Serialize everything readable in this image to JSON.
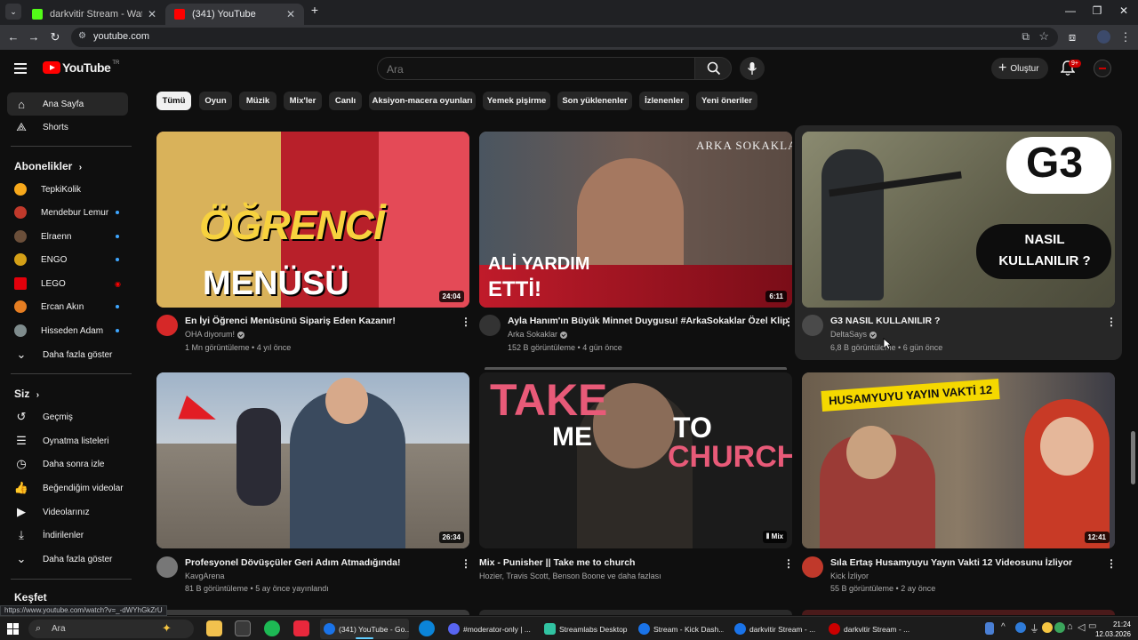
{
  "browser": {
    "tabs": [
      {
        "label": "darkvitir Stream - Watch Live on",
        "favicon_color": "#53fc18",
        "active": false
      },
      {
        "label": "(341) YouTube",
        "favicon_color": "#ff0000",
        "active": true
      }
    ],
    "new_tab": "+",
    "url": "youtube.com",
    "status_url": "https://www.youtube.com/watch?v=_-dWYhGkZrU"
  },
  "header": {
    "logo_text": "YouTube",
    "country_code": "TR",
    "search_placeholder": "Ara",
    "create_label": "Oluştur",
    "notification_count": "9+"
  },
  "sidebar": {
    "main": [
      {
        "label": "Ana Sayfa",
        "icon": "home-icon",
        "active": true
      },
      {
        "label": "Shorts",
        "icon": "shorts-icon",
        "active": false
      }
    ],
    "subscriptions_heading": "Abonelikler",
    "subscriptions": [
      {
        "label": "TepkiKolik",
        "color": "#f7a81b",
        "indicator": "none"
      },
      {
        "label": "Mendebur Lemur",
        "color": "#c0392b",
        "indicator": "dot"
      },
      {
        "label": "Elraenn",
        "color": "#6b4f3a",
        "indicator": "dot"
      },
      {
        "label": "ENGO",
        "color": "#d4a017",
        "indicator": "dot"
      },
      {
        "label": "LEGO",
        "color": "#e3000b",
        "indicator": "live"
      },
      {
        "label": "Ercan Akın",
        "color": "#e67e22",
        "indicator": "dot"
      },
      {
        "label": "Hisseden Adam",
        "color": "#7f8c8d",
        "indicator": "dot"
      }
    ],
    "show_more_subs": "Daha fazla göster",
    "you_heading": "Siz",
    "you_items": [
      {
        "label": "Geçmiş",
        "icon": "history-icon"
      },
      {
        "label": "Oynatma listeleri",
        "icon": "playlist-icon"
      },
      {
        "label": "Daha sonra izle",
        "icon": "watch-later-icon"
      },
      {
        "label": "Beğendiğim videolar",
        "icon": "like-icon"
      },
      {
        "label": "Videolarınız",
        "icon": "your-videos-icon"
      },
      {
        "label": "İndirilenler",
        "icon": "download-icon"
      }
    ],
    "show_more_you": "Daha fazla göster",
    "explore_heading": "Keşfet"
  },
  "chips": [
    "Tümü",
    "Oyun",
    "Müzik",
    "Mix'ler",
    "Canlı",
    "Aksiyon-macera oyunları",
    "Yemek pişirme",
    "Son yüklenenler",
    "İzlenenler",
    "Yeni öneriler"
  ],
  "videos": [
    {
      "title": "En İyi Öğrenci Menüsünü Sipariş Eden Kazanır!",
      "channel": "OHA diyorum!",
      "verified": true,
      "meta": "1 Mn görüntüleme • 4 yıl önce",
      "duration": "24:04",
      "thumb_text": "ÖĞRENCİ MENÜSÜ",
      "thumb_bg": "#b8202a",
      "avatar_color": "#d62828"
    },
    {
      "title": "Ayla Hanım'ın Büyük Minnet Duygusu! #ArkaSokaklar Özel Klip",
      "channel": "Arka Sokaklar",
      "verified": true,
      "meta": "152 B görüntüleme • 4 gün önce",
      "duration": "6:11",
      "thumb_text": "ALİ YARDIM ETTİ!",
      "thumb_corner": "ARKA SOKAKLAR",
      "thumb_bg": "#5a4a42",
      "avatar_color": "#333333"
    },
    {
      "title": "G3 NASIL KULLANILIR ?",
      "channel": "DeltaSays",
      "verified": true,
      "meta": "6,8 B görüntüleme • 6 gün önce",
      "duration": "",
      "thumb_text": "G3",
      "thumb_sub": "NASIL KULLANILIR ?",
      "thumb_bg": "#6b6a55",
      "avatar_color": "#4a4a4a"
    },
    {
      "title": "Profesyonel Dövüşçüler Geri Adım Atmadığında!",
      "channel": "KavgArena",
      "verified": false,
      "meta": "81 B görüntüleme • 5 ay önce yayınlandı",
      "duration": "26:34",
      "thumb_bg": "#7a8a9a",
      "avatar_color": "#777777"
    },
    {
      "title": "Mix - Punisher || Take me to church",
      "channel": "Hozier, Travis Scott, Benson Boone ve daha fazlası",
      "verified": false,
      "meta": "",
      "duration": "Mix",
      "thumb_text_a": "TAKE",
      "thumb_text_b": "ME",
      "thumb_text_c": "TO",
      "thumb_text_d": "CHURCH",
      "thumb_bg": "#1b1b1b",
      "avatar_color": ""
    },
    {
      "title": "Sıla Ertaş Husamyuyu Yayın Vakti 12 Videosunu İzliyor",
      "channel": "Kick İzliyor",
      "verified": false,
      "meta": "55 B görüntüleme • 2 ay önce",
      "duration": "12:41",
      "thumb_text": "HUSAMYUYU YAYIN VAKTİ 12",
      "thumb_bg": "#5d4e3f",
      "avatar_color": "#c0392b"
    }
  ],
  "taskbar": {
    "search_label": "Ara",
    "tasks": [
      {
        "label": "(341) YouTube - Go...",
        "color": "#ff0000",
        "active": true
      },
      {
        "label": "#moderator-only | ...",
        "color": "#5865f2",
        "active": false
      },
      {
        "label": "Streamlabs Desktop",
        "color": "#31c3a2",
        "active": false
      },
      {
        "label": "Stream - Kick Dash...",
        "color": "#1a73e8",
        "active": false
      },
      {
        "label": "darkvitir Stream - ...",
        "color": "#1a73e8",
        "active": false
      },
      {
        "label": "darkvitir Stream - ...",
        "color": "#cc0000",
        "active": false
      }
    ],
    "time": "21:24",
    "date": "12.03.2026"
  }
}
